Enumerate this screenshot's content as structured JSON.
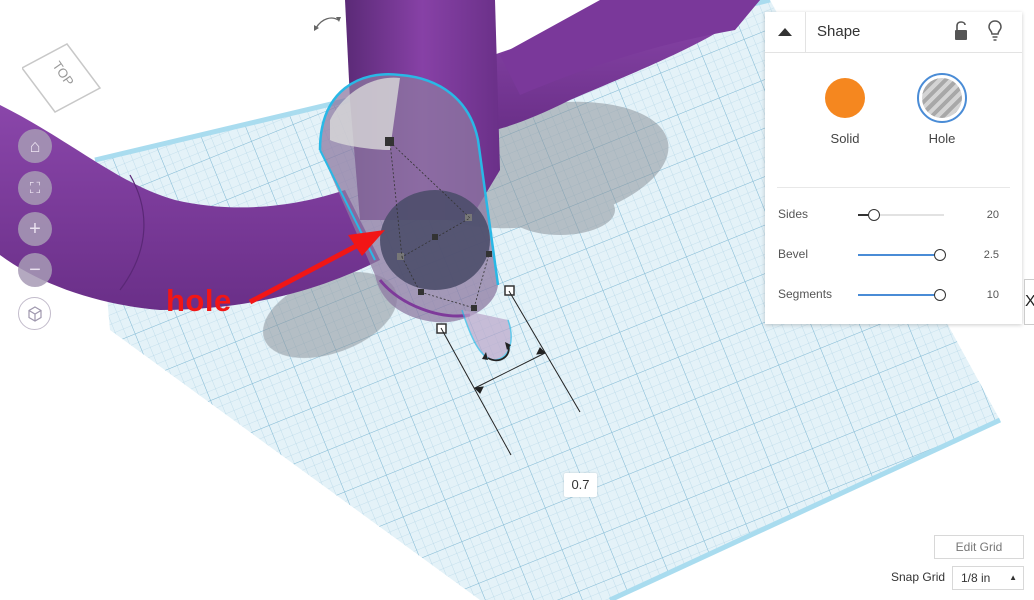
{
  "viewcube": {
    "face_label": "TOP"
  },
  "nav": {
    "home": "⌂",
    "fit": "⛶",
    "zoom_in": "+",
    "zoom_out": "−"
  },
  "dimension": {
    "value": "0.7"
  },
  "annotation": {
    "text": "hole"
  },
  "panel": {
    "title": "Shape",
    "solid_label": "Solid",
    "hole_label": "Hole",
    "properties": [
      {
        "label": "Sides",
        "value": "20",
        "fraction": 0.13
      },
      {
        "label": "Bevel",
        "value": "2.5",
        "fraction": 1.0
      },
      {
        "label": "Segments",
        "value": "10",
        "fraction": 1.0
      }
    ],
    "colors": {
      "solid": "#f5871f",
      "selected_ring": "#4a8cd6"
    }
  },
  "edge_tab": {
    "text": "X"
  },
  "grid": {
    "edit_label": "Edit Grid",
    "snap_label": "Snap Grid",
    "snap_value": "1/8 in"
  },
  "colors": {
    "workplane": "#d9ecf5",
    "object": "#7e3a9a",
    "outline": "#29b8e6"
  }
}
